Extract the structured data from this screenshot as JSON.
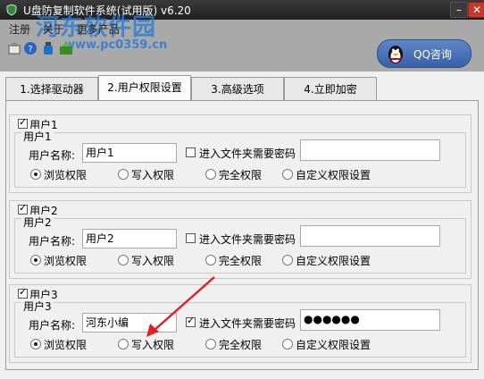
{
  "window": {
    "title": "U盘防复制软件系统(试用版) v6.20"
  },
  "menu": [
    "注册",
    "关于",
    "更多产品"
  ],
  "watermark": {
    "text": "河东软件园",
    "url": "www.pc0359.cn"
  },
  "qq_button": {
    "label": "QQ咨询"
  },
  "tabs": [
    {
      "label": "1.选择驱动器",
      "active": false
    },
    {
      "label": "2.用户权限设置",
      "active": true
    },
    {
      "label": "3.高级选项",
      "active": false
    },
    {
      "label": "4.立即加密",
      "active": false
    }
  ],
  "users": [
    {
      "enable_label": "用户1",
      "enabled": true,
      "group_title": "用户1",
      "name_label": "用户名称:",
      "name_value": "用户1",
      "password_label": "进入文件夹需要密码",
      "password_required": false,
      "password_value": "",
      "permissions": [
        "浏览权限",
        "写入权限",
        "完全权限",
        "自定义权限设置"
      ],
      "selected_permission": "浏览权限"
    },
    {
      "enable_label": "用户2",
      "enabled": true,
      "group_title": "用户2",
      "name_label": "用户名称:",
      "name_value": "用户2",
      "password_label": "进入文件夹需要密码",
      "password_required": false,
      "password_value": "",
      "permissions": [
        "浏览权限",
        "写入权限",
        "完全权限",
        "自定义权限设置"
      ],
      "selected_permission": "浏览权限"
    },
    {
      "enable_label": "用户3",
      "enabled": true,
      "group_title": "用户3",
      "name_label": "用户名称:",
      "name_value": "河东小编",
      "password_label": "进入文件夹需要密码",
      "password_required": true,
      "password_value": "●●●●●●",
      "permissions": [
        "浏览权限",
        "写入权限",
        "完全权限",
        "自定义权限设置"
      ],
      "selected_permission": "浏览权限"
    }
  ],
  "colors": {
    "titlebar": "#2a2a2a",
    "header": "#a9a9a9",
    "qq_button": "#4a70b6",
    "arrow": "#e02020",
    "watermark": "#2a7bd6"
  }
}
